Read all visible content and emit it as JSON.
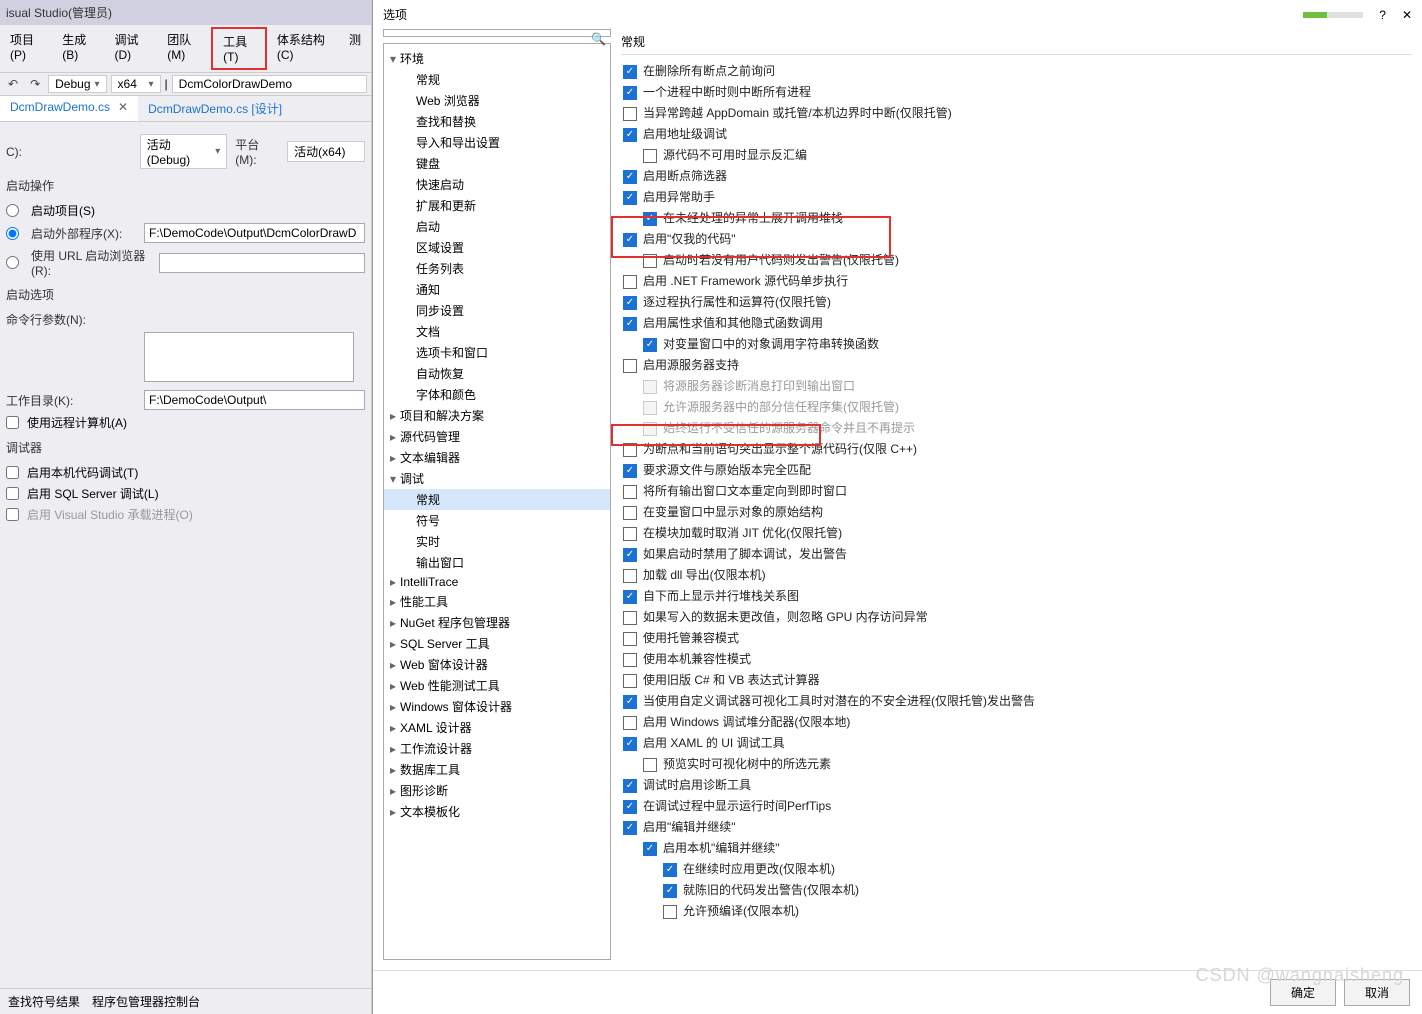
{
  "vs": {
    "title": "isual Studio(管理员)",
    "menu": [
      "项目(P)",
      "生成(B)",
      "调试(D)",
      "团队(M)",
      "工具(T)",
      "体系结构(C)",
      "测"
    ],
    "highlight_menu_index": 4,
    "toolbar": {
      "undo": "↶",
      "redo": "↷",
      "config": "Debug",
      "platform": "x64",
      "target": "DcmColorDrawDemo"
    },
    "tabs": [
      {
        "label": "DcmDrawDemo.cs",
        "active": true
      },
      {
        "label": "DcmDrawDemo.cs [设计]",
        "active": false
      }
    ],
    "form": {
      "config_label": "C):",
      "config_value": "活动(Debug)",
      "platform_label": "平台(M):",
      "platform_value": "活动(x64)",
      "section_start": "启动操作",
      "radio_project": "启动项目(S)",
      "radio_external": "启动外部程序(X):",
      "external_path": "F:\\DemoCode\\Output\\DcmColorDrawD",
      "radio_url": "使用 URL 启动浏览器(R):",
      "section_options": "启动选项",
      "cmdline_label": "命令行参数(N):",
      "workdir_label": "工作目录(K):",
      "workdir_value": "F:\\DemoCode\\Output\\",
      "remote_label": "使用远程计算机(A)",
      "section_debugger": "调试器",
      "native_label": "启用本机代码调试(T)",
      "sql_label": "启用 SQL Server 调试(L)",
      "host_label": "启用 Visual Studio 承载进程(O)"
    },
    "bottom": {
      "findresults": "查找符号结果",
      "pkgconsole": "程序包管理器控制台"
    }
  },
  "dialog": {
    "title": "选项",
    "help": "?",
    "close": "✕",
    "search_placeholder": "",
    "right_head": "常规",
    "tree": [
      {
        "label": "环境",
        "level": 0,
        "expanded": true
      },
      {
        "label": "常规",
        "level": 1
      },
      {
        "label": "Web 浏览器",
        "level": 1
      },
      {
        "label": "查找和替换",
        "level": 1
      },
      {
        "label": "导入和导出设置",
        "level": 1
      },
      {
        "label": "键盘",
        "level": 1
      },
      {
        "label": "快速启动",
        "level": 1
      },
      {
        "label": "扩展和更新",
        "level": 1
      },
      {
        "label": "启动",
        "level": 1
      },
      {
        "label": "区域设置",
        "level": 1
      },
      {
        "label": "任务列表",
        "level": 1
      },
      {
        "label": "通知",
        "level": 1
      },
      {
        "label": "同步设置",
        "level": 1
      },
      {
        "label": "文档",
        "level": 1
      },
      {
        "label": "选项卡和窗口",
        "level": 1
      },
      {
        "label": "自动恢复",
        "level": 1
      },
      {
        "label": "字体和颜色",
        "level": 1
      },
      {
        "label": "项目和解决方案",
        "level": 0,
        "collapsed": true
      },
      {
        "label": "源代码管理",
        "level": 0,
        "collapsed": true
      },
      {
        "label": "文本编辑器",
        "level": 0,
        "collapsed": true
      },
      {
        "label": "调试",
        "level": 0,
        "expanded": true
      },
      {
        "label": "常规",
        "level": 1,
        "selected": true
      },
      {
        "label": "符号",
        "level": 1
      },
      {
        "label": "实时",
        "level": 1
      },
      {
        "label": "输出窗口",
        "level": 1
      },
      {
        "label": "IntelliTrace",
        "level": 0,
        "collapsed": true
      },
      {
        "label": "性能工具",
        "level": 0,
        "collapsed": true
      },
      {
        "label": "NuGet 程序包管理器",
        "level": 0,
        "collapsed": true
      },
      {
        "label": "SQL Server 工具",
        "level": 0,
        "collapsed": true
      },
      {
        "label": "Web 窗体设计器",
        "level": 0,
        "collapsed": true
      },
      {
        "label": "Web 性能测试工具",
        "level": 0,
        "collapsed": true
      },
      {
        "label": "Windows 窗体设计器",
        "level": 0,
        "collapsed": true
      },
      {
        "label": "XAML 设计器",
        "level": 0,
        "collapsed": true
      },
      {
        "label": "工作流设计器",
        "level": 0,
        "collapsed": true
      },
      {
        "label": "数据库工具",
        "level": 0,
        "collapsed": true
      },
      {
        "label": "图形诊断",
        "level": 0,
        "collapsed": true
      },
      {
        "label": "文本模板化",
        "level": 0,
        "collapsed": true
      }
    ],
    "options": [
      {
        "label": "在删除所有断点之前询问",
        "indent": 0,
        "checked": true
      },
      {
        "label": "一个进程中断时则中断所有进程",
        "indent": 0,
        "checked": true
      },
      {
        "label": "当异常跨越 AppDomain 或托管/本机边界时中断(仅限托管)",
        "indent": 0,
        "checked": false
      },
      {
        "label": "启用地址级调试",
        "indent": 0,
        "checked": true
      },
      {
        "label": "源代码不可用时显示反汇编",
        "indent": 1,
        "checked": false
      },
      {
        "label": "启用断点筛选器",
        "indent": 0,
        "checked": true
      },
      {
        "label": "启用异常助手",
        "indent": 0,
        "checked": true
      },
      {
        "label": "在未经处理的异常上展开调用堆栈",
        "indent": 1,
        "checked": true
      },
      {
        "label": "启用\"仅我的代码\"",
        "indent": 0,
        "checked": true
      },
      {
        "label": "启动时若没有用户代码则发出警告(仅限托管)",
        "indent": 1,
        "checked": false
      },
      {
        "label": "启用 .NET Framework 源代码单步执行",
        "indent": 0,
        "checked": false
      },
      {
        "label": "逐过程执行属性和运算符(仅限托管)",
        "indent": 0,
        "checked": true
      },
      {
        "label": "启用属性求值和其他隐式函数调用",
        "indent": 0,
        "checked": true
      },
      {
        "label": "对变量窗口中的对象调用字符串转换函数",
        "indent": 1,
        "checked": true
      },
      {
        "label": "启用源服务器支持",
        "indent": 0,
        "checked": false
      },
      {
        "label": "将源服务器诊断消息打印到输出窗口",
        "indent": 1,
        "checked": false,
        "disabled": true
      },
      {
        "label": "允许源服务器中的部分信任程序集(仅限托管)",
        "indent": 1,
        "checked": false,
        "disabled": true
      },
      {
        "label": "始终运行不受信任的源服务器命令并且不再提示",
        "indent": 1,
        "checked": false,
        "disabled": true
      },
      {
        "label": "为断点和当前语句突出显示整个源代码行(仅限 C++)",
        "indent": 0,
        "checked": false
      },
      {
        "label": "要求源文件与原始版本完全匹配",
        "indent": 0,
        "checked": true
      },
      {
        "label": "将所有输出窗口文本重定向到即时窗口",
        "indent": 0,
        "checked": false
      },
      {
        "label": "在变量窗口中显示对象的原始结构",
        "indent": 0,
        "checked": false
      },
      {
        "label": "在模块加载时取消 JIT 优化(仅限托管)",
        "indent": 0,
        "checked": false
      },
      {
        "label": "如果启动时禁用了脚本调试，发出警告",
        "indent": 0,
        "checked": true
      },
      {
        "label": "加载 dll 导出(仅限本机)",
        "indent": 0,
        "checked": false
      },
      {
        "label": "自下而上显示并行堆栈关系图",
        "indent": 0,
        "checked": true
      },
      {
        "label": "如果写入的数据未更改值，则忽略 GPU 内存访问异常",
        "indent": 0,
        "checked": false
      },
      {
        "label": "使用托管兼容模式",
        "indent": 0,
        "checked": false
      },
      {
        "label": "使用本机兼容性模式",
        "indent": 0,
        "checked": false
      },
      {
        "label": "使用旧版 C# 和 VB 表达式计算器",
        "indent": 0,
        "checked": false
      },
      {
        "label": "当使用自定义调试器可视化工具时对潜在的不安全进程(仅限托管)发出警告",
        "indent": 0,
        "checked": true
      },
      {
        "label": "启用 Windows 调试堆分配器(仅限本地)",
        "indent": 0,
        "checked": false
      },
      {
        "label": "启用 XAML 的 UI 调试工具",
        "indent": 0,
        "checked": true
      },
      {
        "label": "预览实时可视化树中的所选元素",
        "indent": 1,
        "checked": false
      },
      {
        "label": "调试时启用诊断工具",
        "indent": 0,
        "checked": true
      },
      {
        "label": "在调试过程中显示运行时间PerfTips",
        "indent": 0,
        "checked": true
      },
      {
        "label": "启用\"编辑并继续\"",
        "indent": 0,
        "checked": true
      },
      {
        "label": "启用本机\"编辑并继续\"",
        "indent": 1,
        "checked": true
      },
      {
        "label": "在继续时应用更改(仅限本机)",
        "indent": 2,
        "checked": true
      },
      {
        "label": "就陈旧的代码发出警告(仅限本机)",
        "indent": 2,
        "checked": true
      },
      {
        "label": "允许预编译(仅限本机)",
        "indent": 2,
        "checked": false
      }
    ],
    "buttons": {
      "ok": "确定",
      "cancel": "取消"
    }
  },
  "watermark": "CSDN @wangnaisheng"
}
